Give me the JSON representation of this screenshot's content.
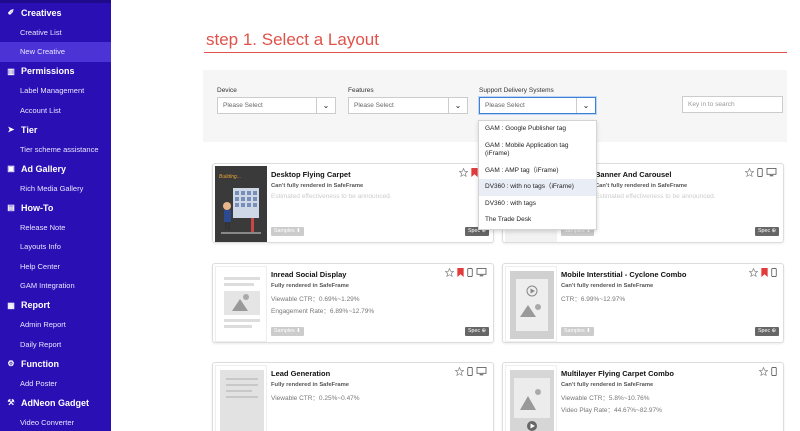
{
  "sidebar": {
    "groups": [
      {
        "label": "Creatives",
        "icon": "magic-wand-icon",
        "items": [
          {
            "label": "Creative List"
          },
          {
            "label": "New Creative"
          }
        ]
      },
      {
        "label": "Permissions",
        "icon": "bank-icon",
        "items": [
          {
            "label": "Label Management"
          },
          {
            "label": "Account List"
          }
        ]
      },
      {
        "label": "Tier",
        "icon": "paper-plane-icon",
        "items": [
          {
            "label": "Tier scheme assistance"
          }
        ]
      },
      {
        "label": "Ad Gallery",
        "icon": "image-icon",
        "items": [
          {
            "label": "Rich Media Gallery"
          }
        ]
      },
      {
        "label": "How-To",
        "icon": "document-icon",
        "items": [
          {
            "label": "Release Note"
          },
          {
            "label": "Layouts Info"
          },
          {
            "label": "Help Center"
          },
          {
            "label": "GAM Integration"
          }
        ]
      },
      {
        "label": "Report",
        "icon": "bar-chart-icon",
        "items": [
          {
            "label": "Admin Report"
          },
          {
            "label": "Daily Report"
          }
        ]
      },
      {
        "label": "Function",
        "icon": "gears-icon",
        "items": [
          {
            "label": "Add Poster"
          }
        ]
      },
      {
        "label": "AdNeon Gadget",
        "icon": "wrench-icon",
        "items": [
          {
            "label": "Video Converter"
          }
        ]
      }
    ],
    "active_item": "New Creative"
  },
  "page": {
    "title": "step 1. Select a Layout"
  },
  "filters": {
    "device": {
      "label": "Device",
      "value": "Please Select"
    },
    "features": {
      "label": "Features",
      "value": "Please Select"
    },
    "delivery": {
      "label": "Support Delivery Systems",
      "value": "Please Select"
    },
    "search": {
      "placeholder": "Key in to search"
    }
  },
  "dropdown": {
    "options": [
      "GAM : Google Publisher tag",
      "GAM : Mobile Application tag (iFrame)",
      "GAM : AMP tag（iFrame)",
      "DV360 : with no tags（iFrame)",
      "DV360 : with tags",
      "The Trade Desk"
    ],
    "highlighted_index": 3
  },
  "cards": [
    {
      "title": "Desktop Flying Carpet",
      "subtitle": "Can't fully rendered in SafeFrame",
      "line1": "Estimated effectiveness to be announced.",
      "line2": "",
      "samples": "Samples ⬇",
      "spec": "Spec ⊕",
      "thumb_text": "Building...",
      "bookmark_color": "#e23b3b"
    },
    {
      "title": "Banner And Carousel",
      "subtitle": "Can't fully rendered in SafeFrame",
      "line1": "Estimated effectiveness to be announced.",
      "line2": "",
      "samples": "Samples ⬇",
      "spec": "Spec ⊕"
    },
    {
      "title": "Inread Social Display",
      "subtitle": "Fully rendered in SafeFrame",
      "line1": "Viewable CTR：0.69%~1.29%",
      "line2": "Engagement Rate：6.89%~12.79%",
      "samples": "Samples ⬇",
      "spec": "Spec ⊕",
      "bookmark_color": "#e23b3b"
    },
    {
      "title": "Mobile Interstitial - Cyclone Combo",
      "subtitle": "Can't fully rendered in SafeFrame",
      "line1": "CTR：6.99%~12.97%",
      "line2": "",
      "samples": "Samples ⬇",
      "spec": "Spec ⊕",
      "bookmark_color": "#e23b3b"
    },
    {
      "title": "Lead Generation",
      "subtitle": "Fully rendered in SafeFrame",
      "line1": "Viewable CTR：0.25%~0.47%",
      "line2": "",
      "samples": "",
      "spec": ""
    },
    {
      "title": "Multilayer Flying Carpet Combo",
      "subtitle": "Can't fully rendered in SafeFrame",
      "line1": "Viewable CTR：5.8%~10.76%",
      "line2": "Video Play Rate：44.67%~82.97%",
      "samples": "",
      "spec": ""
    }
  ]
}
